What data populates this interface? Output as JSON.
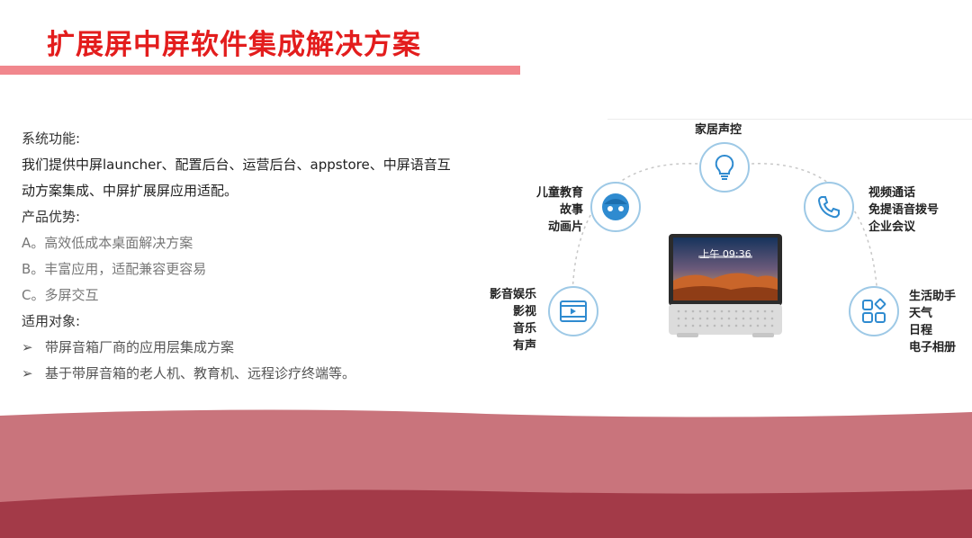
{
  "title": "扩展屏中屏软件集成解决方案",
  "colors": {
    "title": "#e31d1d",
    "accent_bar": "#f1878d",
    "icon_blue": "#2f8bd0",
    "wave_light": "#c9747c",
    "wave_dark": "#a33a48"
  },
  "content": {
    "func_title": "系统功能:",
    "func_line1": "我们提供中屏launcher、配置后台、运营后台、appstore、中屏语音互",
    "func_line2": "动方案集成、中屏扩展屏应用适配。",
    "adv_title": "产品优势:",
    "adv": [
      "A。高效低成本桌面解决方案",
      "B。丰富应用，适配兼容更容易",
      "C。多屏交互"
    ],
    "target_title": "适用对象:",
    "bullet_symbol": "➢",
    "targets": [
      "带屏音箱厂商的应用层集成方案",
      "基于带屏音箱的老人机、教育机、远程诊疗终端等。"
    ]
  },
  "diagram": {
    "top": {
      "icon": "lightbulb-icon",
      "label": "家居声控"
    },
    "upper_left": {
      "icon": "face-icon",
      "labels": [
        "儿童教育",
        "故事",
        "动画片"
      ]
    },
    "upper_right": {
      "icon": "phone-icon",
      "labels": [
        "视频通话",
        "免提语音拨号",
        "企业会议"
      ]
    },
    "lower_left": {
      "icon": "video-icon",
      "labels": [
        "影音娱乐",
        "影视",
        "音乐",
        "有声"
      ]
    },
    "lower_right": {
      "icon": "apps-icon",
      "labels": [
        "生活助手",
        "天气",
        "日程",
        "电子相册"
      ]
    },
    "device_time": "上午 09:36"
  }
}
